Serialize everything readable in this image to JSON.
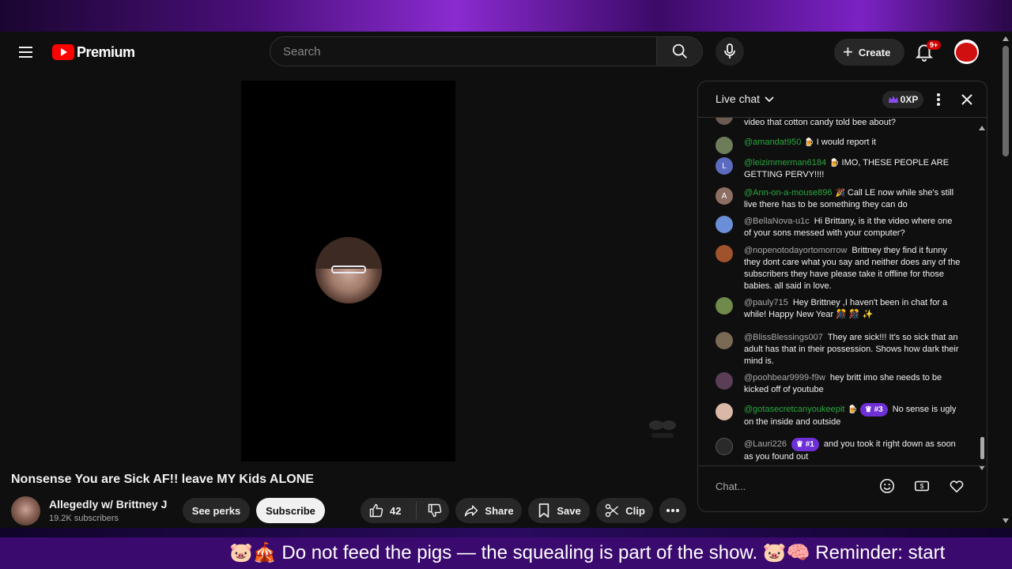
{
  "masthead": {
    "brand": "Premium",
    "search_placeholder": "Search",
    "create_label": "Create",
    "notification_count": "9+"
  },
  "video": {
    "title": "Nonsense You are Sick AF!! leave MY Kids ALONE",
    "channel_name": "Allegedly w/ Brittney J",
    "subscribers": "19.2K subscribers",
    "perks_label": "See perks",
    "subscribe_label": "Subscribe",
    "likes": "42",
    "share_label": "Share",
    "save_label": "Save",
    "clip_label": "Clip"
  },
  "chat": {
    "title": "Live chat",
    "xp": "0XP",
    "input_placeholder": "Chat...",
    "messages": [
      {
        "author": "",
        "text": "video that cotton candy told bee about?"
      },
      {
        "author": "@amandat950",
        "text": "I would report it"
      },
      {
        "author": "@leizimmerman6184",
        "text": "IMO, THESE PEOPLE ARE GETTING PERVY!!!!",
        "initial": "L"
      },
      {
        "author": "@Ann-on-a-mouse896",
        "text": "Call LE now while she's still live there has to be something they can do",
        "initial": "A"
      },
      {
        "author": "@BellaNova-u1c",
        "text": "Hi Brittany, is it the video where one of your sons messed with your computer?"
      },
      {
        "author": "@nopenotodayortomorrow",
        "text": "Brittney they find it funny they dont care what you say and neither does any of the subscribers they have please take it offline for those babies. all said in love."
      },
      {
        "author": "@pauly715",
        "text": "Hey Brittney ,I haven't been in chat for a while! Happy New Year 🎊 🎊 ✨"
      },
      {
        "author": "@BlissBlessings007",
        "text": "They are sick!!! It's so sick that an adult has that in their possession. Shows how dark their mind is."
      },
      {
        "author": "@poohbear9999-f9w",
        "text": "hey britt imo she needs to be kicked off of youtube"
      },
      {
        "author": "@gotasecretcanyoukeepit",
        "badge": "#3",
        "text": "No sense is ugly on the inside and outside"
      },
      {
        "author": "@Lauri226",
        "badge": "#1",
        "text": "and you took it right down as soon as you found out"
      }
    ]
  },
  "ticker": {
    "text": "🐷🎪 Do not feed the pigs — the squealing is part of the show. 🐷🧠 Reminder: start"
  },
  "colors": {
    "accent_red": "#ff0000",
    "member_purple": "#6f2fd6",
    "author_green": "#2ba640",
    "ticker_bg": "#3a0a6e"
  }
}
